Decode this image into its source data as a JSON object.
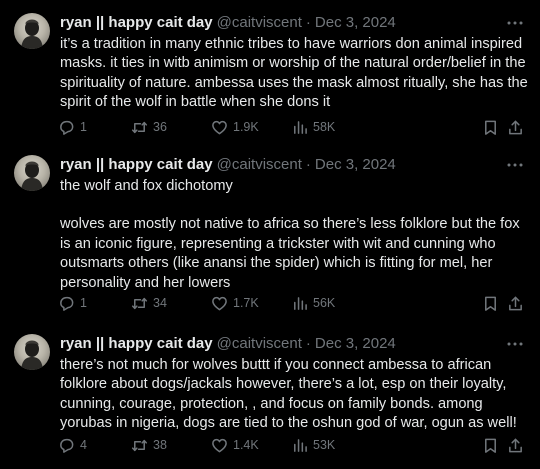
{
  "tweets": [
    {
      "author_name": "ryan || happy cait day",
      "handle": "@caitviscent",
      "separator": "·",
      "date": "Dec 3, 2024",
      "paragraphs": [
        "it’s a tradition in many ethnic tribes to have warriors don animal inspired masks. it ties in witb animism or worship of the natural order/belief in the spirituality of nature. ambessa uses the mask almost ritually, she has the spirit of the wolf in battle when she dons it"
      ],
      "replies": "1",
      "retweets": "36",
      "likes": "1.9K",
      "views": "58K"
    },
    {
      "author_name": "ryan || happy cait day",
      "handle": "@caitviscent",
      "separator": "·",
      "date": "Dec 3, 2024",
      "paragraphs": [
        "the wolf and fox dichotomy",
        "wolves are mostly not native to africa so there’s less folklore but the fox is an iconic figure, representing a trickster with wit and cunning who outsmarts others (like anansi the spider) which is fitting for mel, her personality and her lowers"
      ],
      "replies": "1",
      "retweets": "34",
      "likes": "1.7K",
      "views": "56K"
    },
    {
      "author_name": "ryan || happy cait day",
      "handle": "@caitviscent",
      "separator": "·",
      "date": "Dec 3, 2024",
      "paragraphs": [
        "there’s not much for wolves buttt if you connect ambessa to african folklore about dogs/jackals however, there’s a lot, esp on their loyalty, cunning, courage, protection, , and focus on family bonds. among yorubas in nigeria, dogs are tied to the oshun god of war, ogun as well!"
      ],
      "replies": "4",
      "retweets": "38",
      "likes": "1.4K",
      "views": "53K"
    }
  ],
  "icons": {
    "more": "more-horizontal-icon",
    "reply": "reply-icon",
    "retweet": "retweet-icon",
    "like": "heart-icon",
    "views": "views-icon",
    "bookmark": "bookmark-icon",
    "share": "share-icon"
  },
  "colors": {
    "background": "#000000",
    "text": "#e7e9ea",
    "secondary": "#71767b"
  }
}
